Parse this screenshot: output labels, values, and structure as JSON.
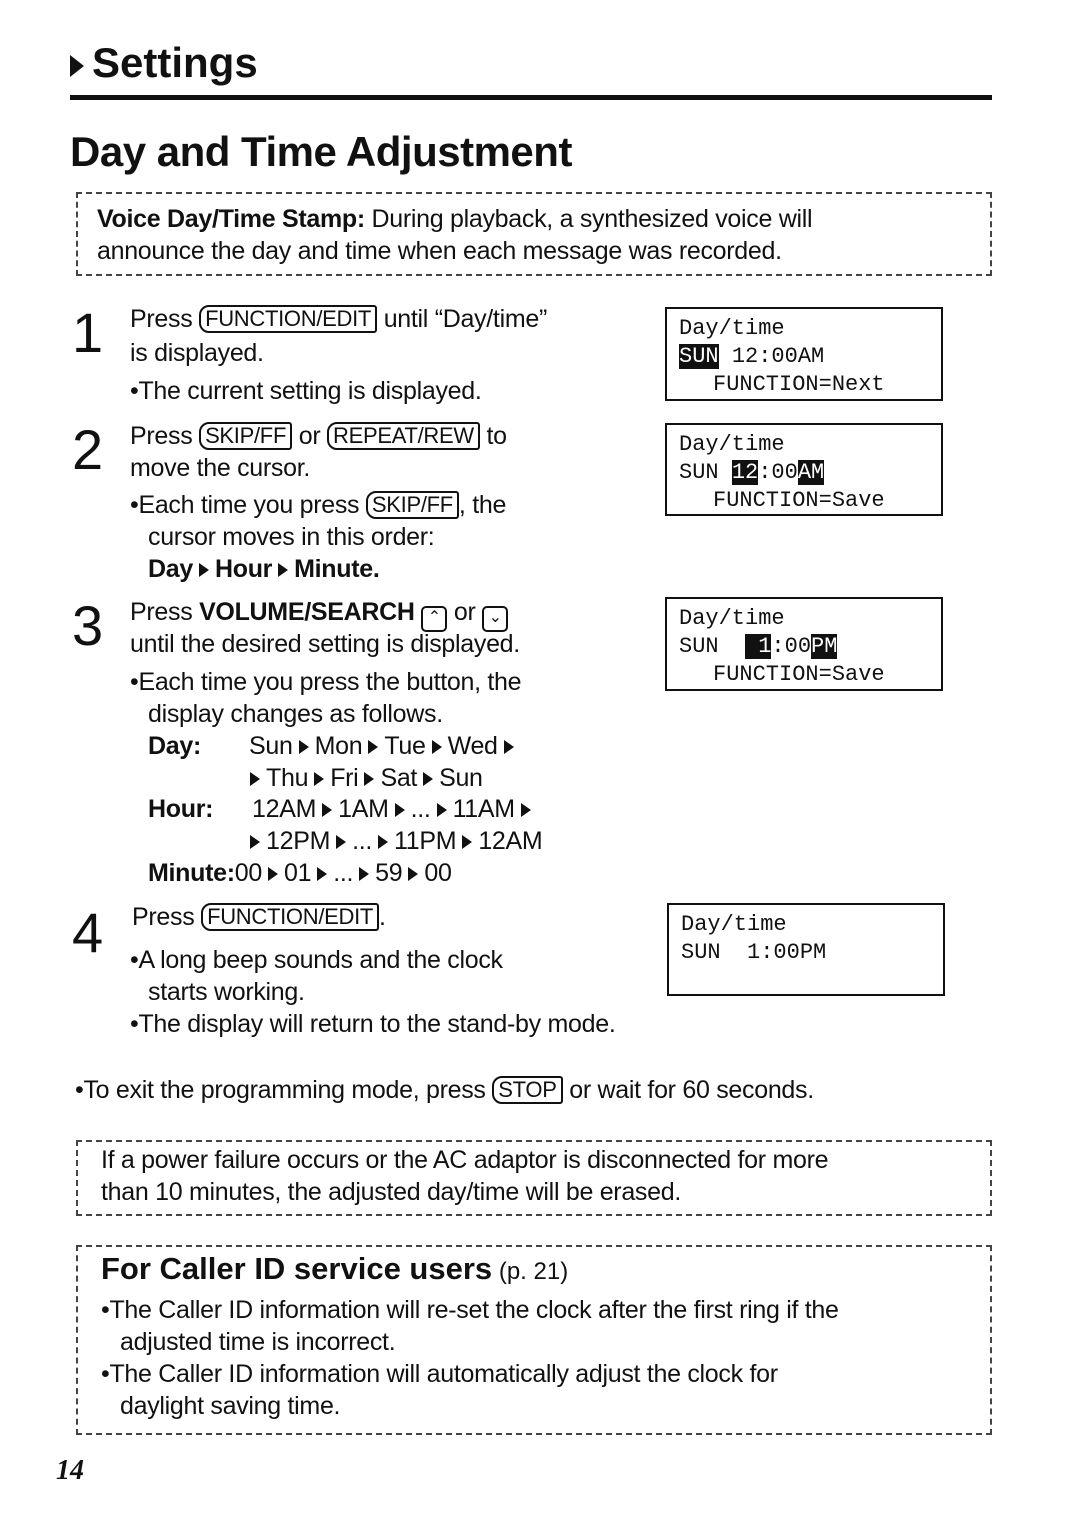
{
  "section_title": "Settings",
  "page_heading": "Day and Time Adjustment",
  "note_top": {
    "bold": "Voice Day/Time Stamp:",
    "line1": " During playback, a synthesized voice will",
    "line2": "announce the day and time when each message was recorded."
  },
  "step1": {
    "num": "1",
    "press": "Press ",
    "key": "FUNCTION/EDIT",
    "until": " until “Day/time”",
    "line2": "is displayed.",
    "bullet": "•The current setting is displayed."
  },
  "step2": {
    "num": "2",
    "press": "Press ",
    "key1": "SKIP/FF",
    "or": " or ",
    "key2": "REPEAT/REW",
    "to": " to",
    "line2": "move the cursor.",
    "bullet_a": "•Each time you press ",
    "bullet_key": "SKIP/FF",
    "bullet_b": ", the",
    "bullet_line2": "cursor moves in this order:",
    "order": [
      "Day",
      "Hour",
      "Minute."
    ]
  },
  "step3": {
    "num": "3",
    "press": "Press ",
    "bold": "VOLUME/SEARCH",
    "up_icon": "up-chevron-icon",
    "or": " or ",
    "down_icon": "down-chevron-icon",
    "line2": "until the desired setting is displayed.",
    "bullet": "•Each time you press the button, the",
    "bullet_line2": "display changes as follows.",
    "day_label": "Day:",
    "day_row1": [
      "Sun",
      "Mon",
      "Tue",
      "Wed"
    ],
    "day_row2": [
      "Thu",
      "Fri",
      "Sat",
      "Sun"
    ],
    "hour_label": "Hour:",
    "hour_row1": [
      "12AM",
      "1AM",
      "...",
      "11AM"
    ],
    "hour_row2": [
      "12PM",
      "...",
      "11PM",
      "12AM"
    ],
    "minute_label": "Minute:",
    "minute_row": [
      "00",
      "01",
      "...",
      "59",
      "00"
    ]
  },
  "step4": {
    "num": "4",
    "press": "Press ",
    "key": "FUNCTION/EDIT",
    "end": ".",
    "bullet1": "•A long beep sounds and the clock",
    "bullet1_line2": "starts working.",
    "bullet2": "•The display will return to the stand-by mode."
  },
  "exit_note": {
    "a": "•To exit the programming mode, press ",
    "key": "STOP",
    "b": " or wait for 60 seconds."
  },
  "note_power": {
    "line1": "If a power failure occurs or the AC adaptor is disconnected for more",
    "line2": "than 10 minutes, the adjusted day/time will be erased."
  },
  "caller_id": {
    "title": "For Caller ID service users",
    "ref": " (p. 21)",
    "b1": "•The Caller ID information will re-set the clock after the first ring if the",
    "b1_line2": "adjusted time is incorrect.",
    "b2": "•The Caller ID information will automatically adjust the clock for",
    "b2_line2": "daylight saving time."
  },
  "lcd": [
    {
      "line1": "Day/time",
      "day": "SUN",
      "hour": "12",
      "min": ":00",
      "ampm": "AM",
      "line3": "FUNCTION=Next",
      "highlight": "day"
    },
    {
      "line1": "Day/time",
      "day": "SUN",
      "hour": "12",
      "min": ":00",
      "ampm": "AM",
      "line3": "FUNCTION=Save",
      "highlight": "hour+ampm"
    },
    {
      "line1": "Day/time",
      "day": "SUN",
      "hour": " 1",
      "min": ":00",
      "ampm": "PM",
      "line3": "FUNCTION=Save",
      "highlight": "hour+ampm"
    },
    {
      "line1": "Day/time",
      "text": "SUN  1:00PM"
    }
  ],
  "page_number": "14"
}
